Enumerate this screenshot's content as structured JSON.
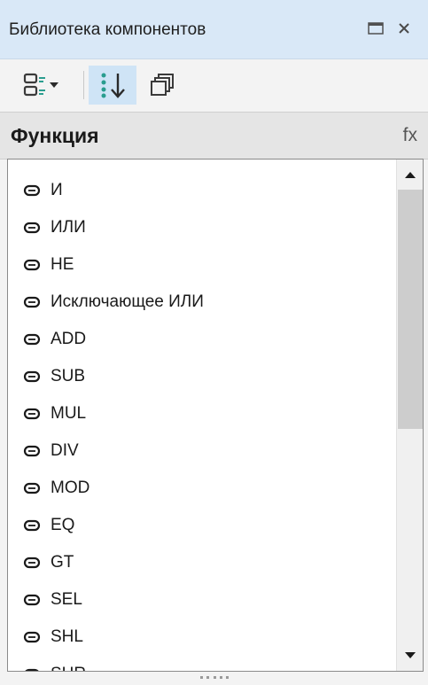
{
  "panel": {
    "title": "Библиотека компонентов",
    "maximize_icon": "maximize-icon",
    "close_icon": "close-icon"
  },
  "toolbar": {
    "items": [
      {
        "name": "view-mode",
        "icon": "list-view-icon",
        "has_dropdown": true
      },
      {
        "name": "sort",
        "icon": "sort-icon",
        "active": true
      },
      {
        "name": "collapse",
        "icon": "collapse-all-icon"
      }
    ]
  },
  "header": {
    "title": "Функция",
    "fx": "fx"
  },
  "list": {
    "items": [
      {
        "label": "И",
        "icon": "function-block-icon"
      },
      {
        "label": "ИЛИ",
        "icon": "function-block-icon"
      },
      {
        "label": "НЕ",
        "icon": "function-block-icon"
      },
      {
        "label": "Исключающее ИЛИ",
        "icon": "function-block-icon"
      },
      {
        "label": "ADD",
        "icon": "function-block-icon"
      },
      {
        "label": "SUB",
        "icon": "function-block-icon"
      },
      {
        "label": "MUL",
        "icon": "function-block-icon"
      },
      {
        "label": "DIV",
        "icon": "function-block-icon"
      },
      {
        "label": "MOD",
        "icon": "function-block-icon"
      },
      {
        "label": "EQ",
        "icon": "function-block-icon"
      },
      {
        "label": "GT",
        "icon": "function-block-icon"
      },
      {
        "label": "SEL",
        "icon": "function-block-icon"
      },
      {
        "label": "SHL",
        "icon": "function-block-icon"
      },
      {
        "label": "SHR",
        "icon": "function-block-icon"
      }
    ]
  },
  "scrollbar": {
    "position": 0.0
  },
  "colors": {
    "titlebar_bg": "#d9e8f7",
    "active_tool_bg": "#cfe4f6",
    "header_bg": "#e5e5e5",
    "teal_accent": "#2a9d8f"
  }
}
